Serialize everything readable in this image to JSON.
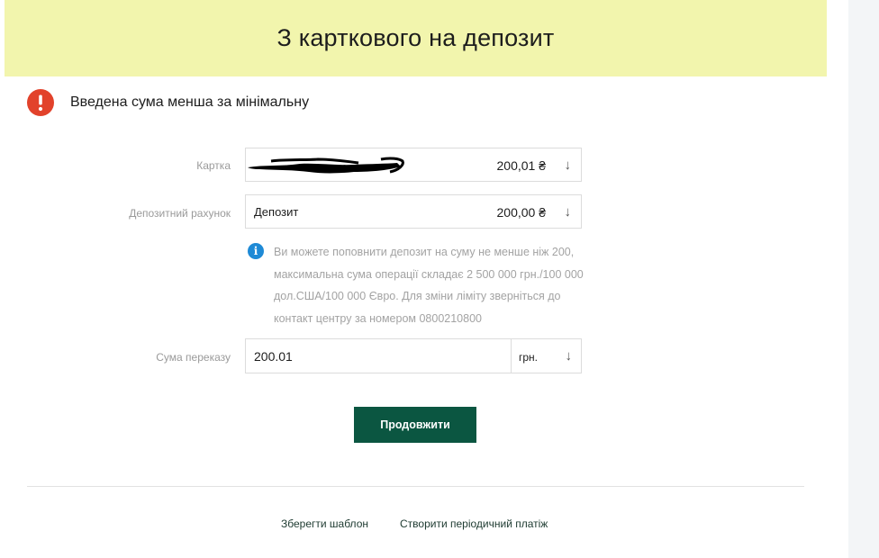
{
  "header": {
    "title": "З карткового на депозит"
  },
  "error": {
    "message": "Введена сума менша за мінімальну",
    "icon": "exclamation-icon",
    "color": "#e2422b"
  },
  "form": {
    "card": {
      "label": "Картка",
      "balance": "200,01 ₴"
    },
    "deposit": {
      "label": "Депозитний рахунок",
      "name": "Депозит",
      "balance": "200,00 ₴"
    },
    "info": {
      "icon": "info-icon",
      "text": "Ви можете поповнити депозит на суму не менше ніж 200, максимальна сума операції складає 2 500 000 грн./100 000 дол.США/100 000 Євро. Для зміни ліміту зверніться до контакт центру за номером 0800210800"
    },
    "amount": {
      "label": "Сума переказу",
      "value": "200.01",
      "currency": "грн."
    },
    "dropdown_arrow": "↓"
  },
  "actions": {
    "continue_label": "Продовжити"
  },
  "footer": {
    "save_template": "Зберегти шаблон",
    "periodic_payment": "Створити періодичний платіж"
  },
  "colors": {
    "header_bg": "#f2f5ad",
    "primary_button": "#0b5641",
    "info": "#1e8ad6"
  }
}
